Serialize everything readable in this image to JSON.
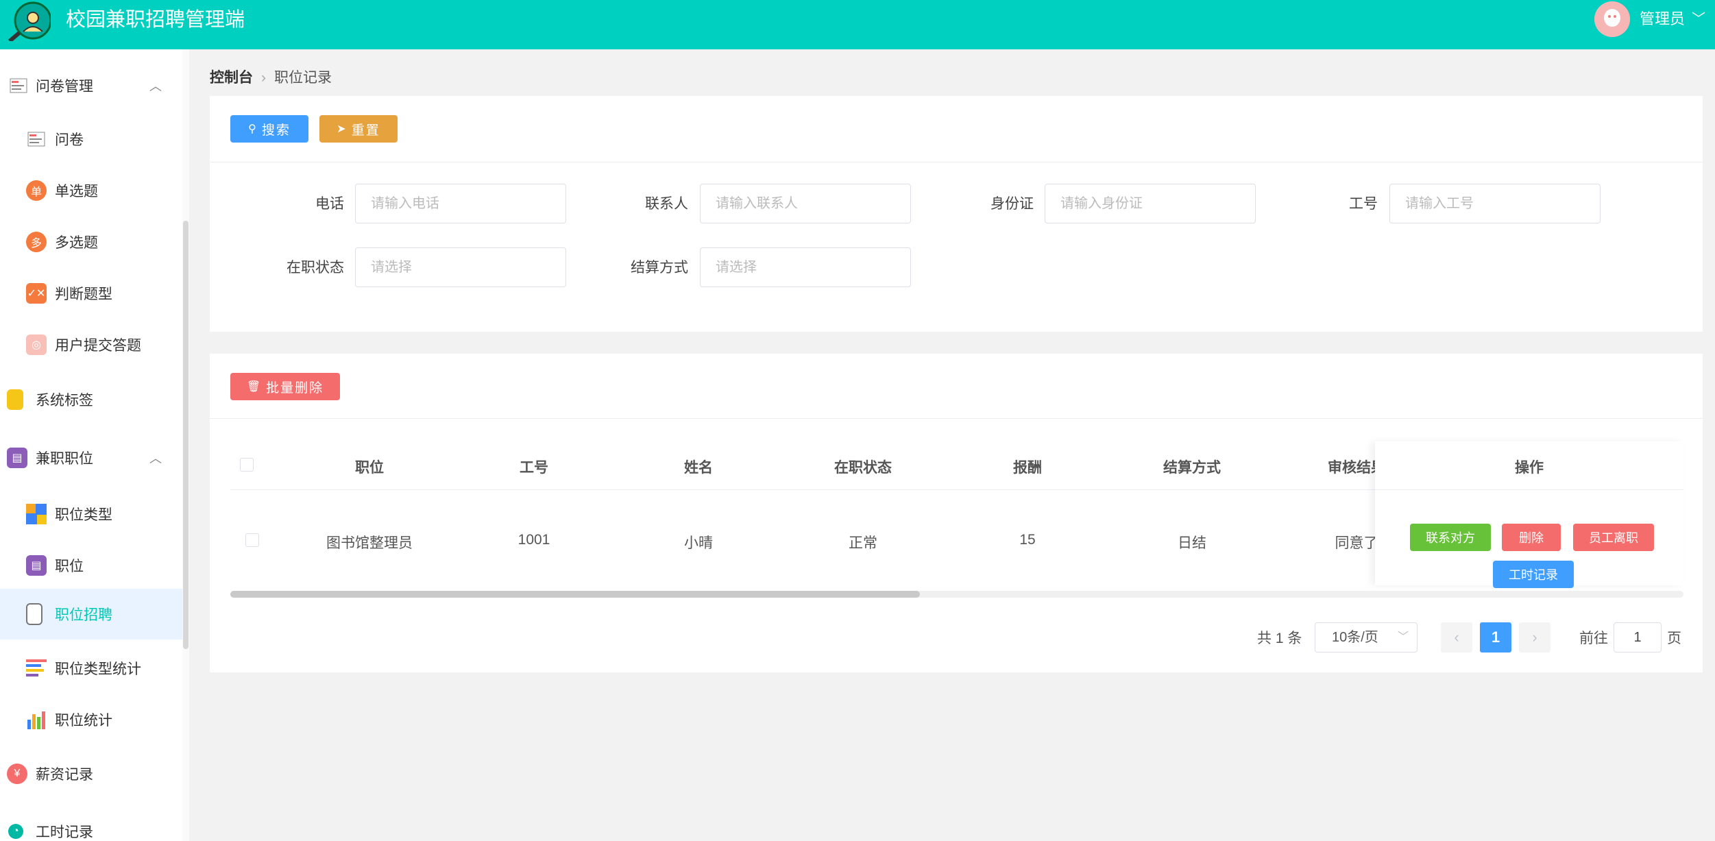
{
  "header": {
    "title": "校园兼职招聘管理端",
    "user_label": "管理员"
  },
  "sidebar": {
    "items": [
      {
        "label": "问卷管理",
        "icon": "survey-icon",
        "expanded": true
      },
      {
        "label": "问卷",
        "icon": "survey-doc-icon"
      },
      {
        "label": "单选题",
        "icon": "single-choice-icon",
        "icon_text": "单"
      },
      {
        "label": "多选题",
        "icon": "multi-choice-icon",
        "icon_text": "多"
      },
      {
        "label": "判断题型",
        "icon": "true-false-icon"
      },
      {
        "label": "用户提交答题",
        "icon": "user-answer-icon"
      },
      {
        "label": "系统标签",
        "icon": "tag-icon"
      },
      {
        "label": "兼职职位",
        "icon": "job-badge-icon",
        "expanded": true
      },
      {
        "label": "职位类型",
        "icon": "job-type-icon"
      },
      {
        "label": "职位",
        "icon": "job-icon"
      },
      {
        "label": "职位招聘",
        "icon": "recruit-icon",
        "active": true
      },
      {
        "label": "职位类型统计",
        "icon": "type-stats-icon"
      },
      {
        "label": "职位统计",
        "icon": "job-stats-icon"
      },
      {
        "label": "薪资记录",
        "icon": "salary-icon"
      },
      {
        "label": "工时记录",
        "icon": "clock-icon"
      }
    ]
  },
  "breadcrumb": {
    "root": "控制台",
    "current": "职位记录"
  },
  "search": {
    "search_label": "搜索",
    "reset_label": "重置",
    "fields": [
      {
        "label": "电话",
        "placeholder": "请输入电话"
      },
      {
        "label": "联系人",
        "placeholder": "请输入联系人"
      },
      {
        "label": "身份证",
        "placeholder": "请输入身份证"
      },
      {
        "label": "工号",
        "placeholder": "请输入工号"
      },
      {
        "label": "在职状态",
        "placeholder": "请选择"
      },
      {
        "label": "结算方式",
        "placeholder": "请选择"
      }
    ]
  },
  "table": {
    "batch_delete_label": "批量删除",
    "columns": [
      "职位",
      "工号",
      "姓名",
      "在职状态",
      "报酬",
      "结算方式",
      "审核结果",
      "操作"
    ],
    "rows": [
      {
        "position": "图书馆整理员",
        "emp_no": "1001",
        "name": "小晴",
        "status": "正常",
        "pay": "15",
        "settlement": "日结",
        "review": "同意了"
      }
    ],
    "actions": {
      "contact": "联系对方",
      "delete": "删除",
      "resign": "员工离职",
      "hours": "工时记录"
    }
  },
  "pagination": {
    "total": "共 1 条",
    "page_size": "10条/页",
    "current": "1",
    "goto_label": "前往",
    "goto_value": "1",
    "page_suffix": "页"
  },
  "colors": {
    "header": "#00d0bf",
    "primary": "#409eff",
    "warning": "#e6a23c",
    "danger": "#f56c6c",
    "success": "#67c23a",
    "active_text": "#00c8b6"
  }
}
